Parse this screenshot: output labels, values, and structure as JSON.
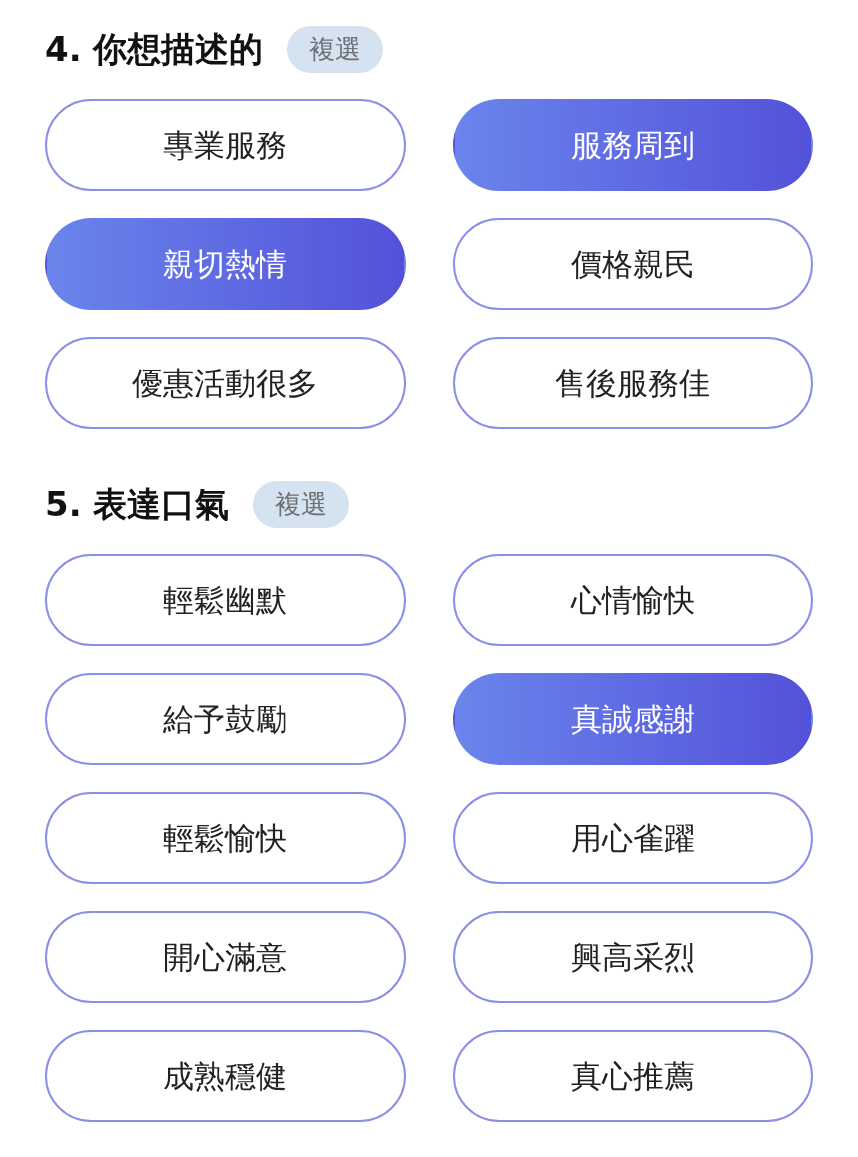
{
  "sections": [
    {
      "title": "4. 你想描述的",
      "badge": "複選",
      "options": [
        {
          "label": "專業服務",
          "selected": false
        },
        {
          "label": "服務周到",
          "selected": true
        },
        {
          "label": "親切熱情",
          "selected": true
        },
        {
          "label": "價格親民",
          "selected": false
        },
        {
          "label": "優惠活動很多",
          "selected": false
        },
        {
          "label": "售後服務佳",
          "selected": false
        }
      ]
    },
    {
      "title": "5. 表達口氣",
      "badge": "複選",
      "options": [
        {
          "label": "輕鬆幽默",
          "selected": false
        },
        {
          "label": "心情愉快",
          "selected": false
        },
        {
          "label": "給予鼓勵",
          "selected": false
        },
        {
          "label": "真誠感謝",
          "selected": true
        },
        {
          "label": "輕鬆愉快",
          "selected": false
        },
        {
          "label": "用心雀躍",
          "selected": false
        },
        {
          "label": "開心滿意",
          "selected": false
        },
        {
          "label": "興高采烈",
          "selected": false
        },
        {
          "label": "成熟穩健",
          "selected": false
        },
        {
          "label": "真心推薦",
          "selected": false
        }
      ]
    }
  ]
}
